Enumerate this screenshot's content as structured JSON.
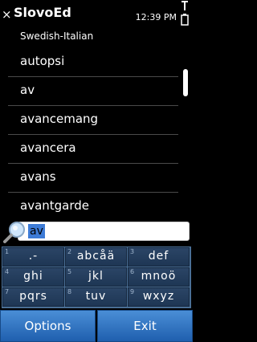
{
  "app": {
    "title": "SlovoEd",
    "close_glyph": "×"
  },
  "status": {
    "time": "12:39 PM"
  },
  "dictionary": {
    "direction": "Swedish-Italian"
  },
  "word_list": {
    "items": [
      "autopsi",
      "av",
      "avancemang",
      "avancera",
      "avans",
      "avantgarde"
    ]
  },
  "search": {
    "value": "av"
  },
  "keypad": {
    "keys": [
      {
        "num": "1",
        "letters": ".-"
      },
      {
        "num": "2",
        "letters": "abcåä"
      },
      {
        "num": "3",
        "letters": "def"
      },
      {
        "num": "4",
        "letters": "ghi"
      },
      {
        "num": "5",
        "letters": "jkl"
      },
      {
        "num": "6",
        "letters": "mnoö"
      },
      {
        "num": "7",
        "letters": "pqrs"
      },
      {
        "num": "8",
        "letters": "tuv"
      },
      {
        "num": "9",
        "letters": "wxyz"
      }
    ]
  },
  "softkeys": {
    "left": "Options",
    "right": "Exit"
  },
  "colors": {
    "background": "#000000",
    "keypad": "#1e3654",
    "softkey": "#2f74c3",
    "selection": "#3d7bd6"
  }
}
